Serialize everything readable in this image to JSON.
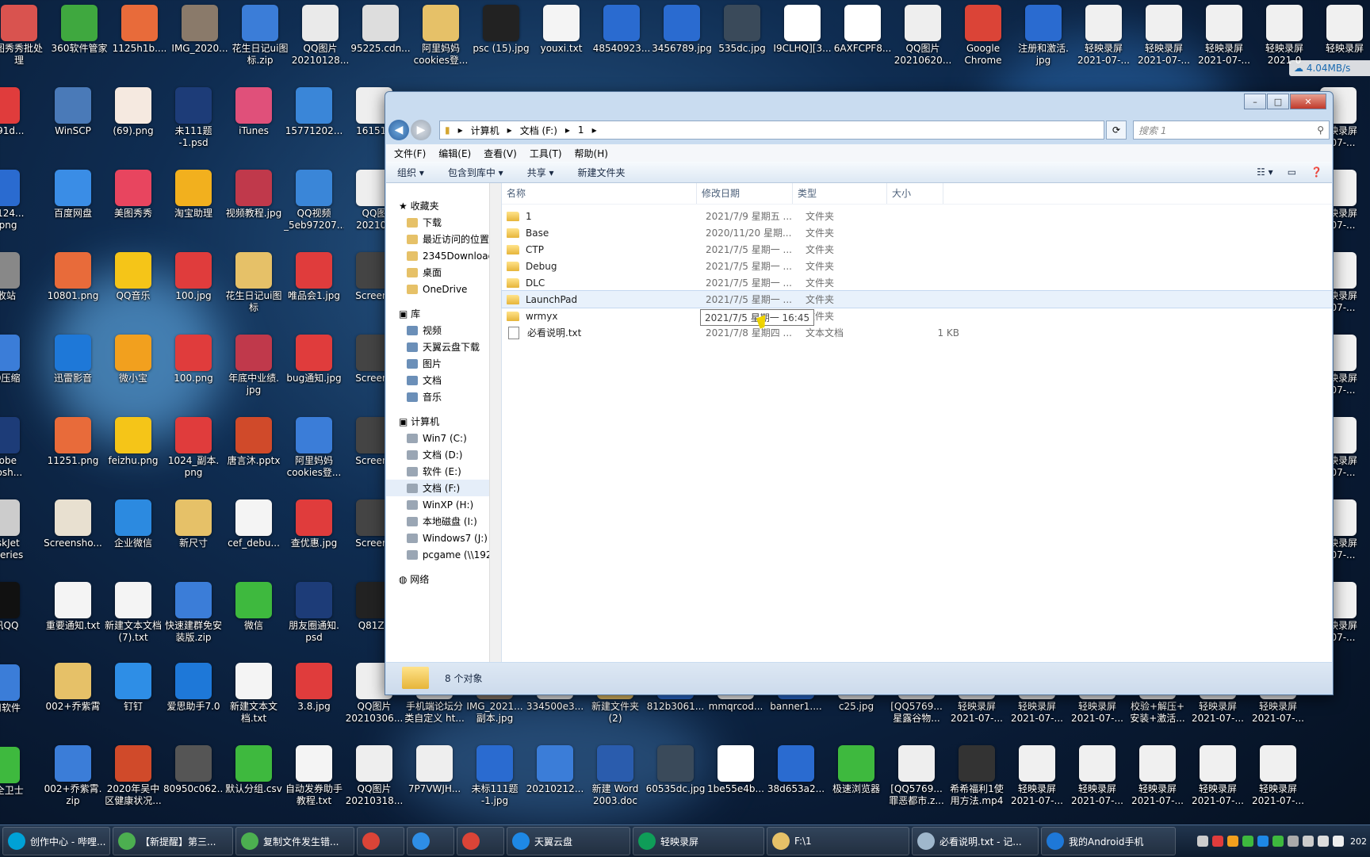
{
  "desktop_icons_top": [
    {
      "label": "图秀秀批处\n理",
      "color": "#d9534f"
    },
    {
      "label": "360软件管家",
      "color": "#3fa83f"
    },
    {
      "label": "1125h1b....",
      "color": "#e86b3a"
    },
    {
      "label": "IMG_2020...",
      "color": "#8a7a6a"
    },
    {
      "label": "花生日记ui图\n标.zip",
      "color": "#3b7dd8"
    },
    {
      "label": "QQ图片\n20210128...",
      "color": "#eaeaea"
    },
    {
      "label": "95225.cdn...",
      "color": "#dddddd"
    },
    {
      "label": "阿里妈妈\ncookies登...",
      "color": "#e6c168"
    },
    {
      "label": "psc (15).jpg",
      "color": "#222222"
    },
    {
      "label": "youxi.txt",
      "color": "#f4f4f4"
    },
    {
      "label": "48540923...",
      "color": "#2a6bd0"
    },
    {
      "label": "3456789.jpg",
      "color": "#2a6bd0"
    },
    {
      "label": "535dc.jpg",
      "color": "#3a4a5a"
    },
    {
      "label": "I9CLHQ][3...",
      "color": "#ffffff"
    },
    {
      "label": "6AXFCPF8...",
      "color": "#ffffff"
    },
    {
      "label": "QQ图片\n20210620...",
      "color": "#eeeeee"
    },
    {
      "label": "Google\nChrome",
      "color": "#db4437"
    },
    {
      "label": "注册和激活.\njpg",
      "color": "#2a6bd0"
    },
    {
      "label": "轻映录屏\n2021-07-...",
      "color": "#f0f0f0"
    },
    {
      "label": "轻映录屏\n2021-07-...",
      "color": "#f0f0f0"
    },
    {
      "label": "轻映录屏\n2021-07-...",
      "color": "#f0f0f0"
    },
    {
      "label": "轻映录屏\n2021-0",
      "color": "#f0f0f0"
    },
    {
      "label": "轻映录屏",
      "color": "#f0f0f0"
    }
  ],
  "desktop_icons_left": [
    {
      "label": "WinSCP",
      "color": "#4a7ab8"
    },
    {
      "label": "(69).png",
      "color": "#f5e9e0"
    },
    {
      "label": "未111题\n-1.psd",
      "color": "#1d3c78"
    },
    {
      "label": "iTunes",
      "color": "#e0507a"
    },
    {
      "label": "15771202...",
      "color": "#3a86d8"
    },
    {
      "label": "161517",
      "color": "#eeeeee"
    },
    {
      "label": "百度网盘",
      "color": "#3a8de6"
    },
    {
      "label": "美图秀秀",
      "color": "#e8455f"
    },
    {
      "label": "淘宝助理",
      "color": "#f2b01e"
    },
    {
      "label": "视频教程.jpg",
      "color": "#c0394b"
    },
    {
      "label": "QQ视频\n_5eb97207...",
      "color": "#3a86d8"
    },
    {
      "label": "QQ图\n202103",
      "color": "#eeeeee"
    },
    {
      "label": "10801.png",
      "color": "#e86b3a"
    },
    {
      "label": "QQ音乐",
      "color": "#f5c518"
    },
    {
      "label": "100.jpg",
      "color": "#e03c3c"
    },
    {
      "label": "花生日记ui图\n标",
      "color": "#e6c168"
    },
    {
      "label": "唯品会1.jpg",
      "color": "#e03c3c"
    },
    {
      "label": "Screens",
      "color": "#444444"
    },
    {
      "label": "迅雷影音",
      "color": "#1e78d8"
    },
    {
      "label": "微小宝",
      "color": "#f2a01e"
    },
    {
      "label": "100.png",
      "color": "#e03c3c"
    },
    {
      "label": "年底中业绩.\njpg",
      "color": "#c0394b"
    },
    {
      "label": "bug通知.jpg",
      "color": "#e03c3c"
    },
    {
      "label": "Screens",
      "color": "#444444"
    },
    {
      "label": "11251.png",
      "color": "#e86b3a"
    },
    {
      "label": "feizhu.png",
      "color": "#f5c518"
    },
    {
      "label": "1024_副本.\npng",
      "color": "#e03c3c"
    },
    {
      "label": "唐言沐.pptx",
      "color": "#d04a2a"
    },
    {
      "label": "阿里妈妈\ncookies登...",
      "color": "#3b7dd8"
    },
    {
      "label": "Screens",
      "color": "#444444"
    },
    {
      "label": "Screensho...",
      "color": "#e8e0d0"
    },
    {
      "label": "企业微信",
      "color": "#2c8ae0"
    },
    {
      "label": "新尺寸",
      "color": "#e6c168"
    },
    {
      "label": "cef_debu...",
      "color": "#f4f4f4"
    },
    {
      "label": "查优惠.jpg",
      "color": "#e03c3c"
    },
    {
      "label": "Screens",
      "color": "#444444"
    },
    {
      "label": "重要通知.txt",
      "color": "#f4f4f4"
    },
    {
      "label": "新建文本文档\n(7).txt",
      "color": "#f4f4f4"
    },
    {
      "label": "快速建群免安\n装版.zip",
      "color": "#3b7dd8"
    },
    {
      "label": "微信",
      "color": "#3eb93e"
    },
    {
      "label": "朋友圈通知.\npsd",
      "color": "#1d3c78"
    },
    {
      "label": "Q81Z7",
      "color": "#222222"
    }
  ],
  "desktop_icons_bottom": [
    {
      "label": "002+乔紫霄",
      "color": "#e6c168"
    },
    {
      "label": "钉钉",
      "color": "#2e8ee6"
    },
    {
      "label": "爱思助手7.0",
      "color": "#1e78d8"
    },
    {
      "label": "新建文本文\n档.txt",
      "color": "#f4f4f4"
    },
    {
      "label": "3.8.jpg",
      "color": "#e03c3c"
    },
    {
      "label": "QQ图片\n20210306...",
      "color": "#eeeeee"
    },
    {
      "label": "手机端论坛分\n类自定义 ht...",
      "color": "#eeeeee"
    },
    {
      "label": "IMG_2021...\n副本.jpg",
      "color": "#8a7a6a"
    },
    {
      "label": "334500e3...",
      "color": "#eeeeee"
    },
    {
      "label": "新建文件夹\n(2)",
      "color": "#e6c168"
    },
    {
      "label": "812b3061...",
      "color": "#2a6bd0"
    },
    {
      "label": "mmqrcod...",
      "color": "#ffffff"
    },
    {
      "label": "banner1....",
      "color": "#2a6bd0"
    },
    {
      "label": "c25.jpg",
      "color": "#eeeeee"
    },
    {
      "label": "[QQ5769...\n星露谷物...",
      "color": "#eeeeee"
    },
    {
      "label": "轻映录屏\n2021-07-...",
      "color": "#f0f0f0"
    },
    {
      "label": "轻映录屏\n2021-07-...",
      "color": "#f0f0f0"
    },
    {
      "label": "轻映录屏\n2021-07-...",
      "color": "#f0f0f0"
    },
    {
      "label": "校验+解压+\n安装+激活...",
      "color": "#f0f0f0"
    },
    {
      "label": "轻映录屏\n2021-07-...",
      "color": "#f0f0f0"
    },
    {
      "label": "轻映录屏\n2021-07-...",
      "color": "#f0f0f0"
    },
    {
      "label": "002+乔紫霄.\nzip",
      "color": "#3b7dd8"
    },
    {
      "label": "2020年吴中\n区健康状况...",
      "color": "#d04a2a"
    },
    {
      "label": "80950c062...",
      "color": "#555555"
    },
    {
      "label": "默认分组.csv",
      "color": "#3eb93e"
    },
    {
      "label": "自动发券助手\n教程.txt",
      "color": "#f4f4f4"
    },
    {
      "label": "QQ图片\n20210318...",
      "color": "#eeeeee"
    },
    {
      "label": "7P7VWJH...",
      "color": "#eeeeee"
    },
    {
      "label": "未标111题\n-1.jpg",
      "color": "#2a6bd0"
    },
    {
      "label": "20210212...",
      "color": "#3b7dd8"
    },
    {
      "label": "新建 Word\n2003.doc",
      "color": "#2a5cad"
    },
    {
      "label": "60535dc.jpg",
      "color": "#3a4a5a"
    },
    {
      "label": "1be55e4b...",
      "color": "#ffffff"
    },
    {
      "label": "38d653a2...",
      "color": "#2a6bd0"
    },
    {
      "label": "极速浏览器",
      "color": "#3eb93e"
    },
    {
      "label": "[QQ5769...\n罪恶都市.z...",
      "color": "#eeeeee"
    },
    {
      "label": "希希福利1使\n用方法.mp4",
      "color": "#333333"
    },
    {
      "label": "轻映录屏\n2021-07-...",
      "color": "#f0f0f0"
    },
    {
      "label": "轻映录屏\n2021-07-...",
      "color": "#f0f0f0"
    },
    {
      "label": "轻映录屏\n2021-07-...",
      "color": "#f0f0f0"
    },
    {
      "label": "轻映录屏\n2021-07-...",
      "color": "#f0f0f0"
    },
    {
      "label": "轻映录屏\n2021-07-...",
      "color": "#f0f0f0"
    }
  ],
  "explorer": {
    "path": [
      "计算机",
      "文档 (F:)",
      "1"
    ],
    "search_placeholder": "搜索 1",
    "menu": [
      "文件(F)",
      "编辑(E)",
      "查看(V)",
      "工具(T)",
      "帮助(H)"
    ],
    "toolbar": [
      "组织 ▾",
      "包含到库中 ▾",
      "共享 ▾",
      "新建文件夹"
    ],
    "nav": {
      "favorites_title": "收藏夹",
      "favorites": [
        "下载",
        "最近访问的位置",
        "2345Download",
        "桌面",
        "OneDrive"
      ],
      "library_title": "库",
      "library": [
        "视频",
        "天翼云盘下载",
        "图片",
        "文档",
        "音乐"
      ],
      "computer_title": "计算机",
      "computer": [
        "Win7 (C:)",
        "文档 (D:)",
        "软件 (E:)",
        "文档 (F:)",
        "WinXP (H:)",
        "本地磁盘 (I:)",
        "Windows7 (J:)",
        "pcgame (\\\\192..."
      ],
      "network_title": "网络"
    },
    "columns": [
      "名称",
      "修改日期",
      "类型",
      "大小"
    ],
    "files": [
      {
        "name": "1",
        "date": "2021/7/9 星期五 ...",
        "type": "文件夹",
        "size": "",
        "kind": "folder"
      },
      {
        "name": "Base",
        "date": "2020/11/20 星期...",
        "type": "文件夹",
        "size": "",
        "kind": "folder"
      },
      {
        "name": "CTP",
        "date": "2021/7/5 星期一 ...",
        "type": "文件夹",
        "size": "",
        "kind": "folder"
      },
      {
        "name": "Debug",
        "date": "2021/7/5 星期一 ...",
        "type": "文件夹",
        "size": "",
        "kind": "folder"
      },
      {
        "name": "DLC",
        "date": "2021/7/5 星期一 ...",
        "type": "文件夹",
        "size": "",
        "kind": "folder"
      },
      {
        "name": "LaunchPad",
        "date": "2021/7/5 星期一 ...",
        "type": "文件夹",
        "size": "",
        "kind": "folder"
      },
      {
        "name": "wrmyx",
        "date": "2021/7/8 星期四 ...",
        "type": "文件夹",
        "size": "",
        "kind": "folder"
      },
      {
        "name": "必看说明.txt",
        "date": "2021/7/8 星期四 ...",
        "type": "文本文档",
        "size": "1 KB",
        "kind": "txt"
      }
    ],
    "tooltip": "2021/7/5 星期一 16:45",
    "status": "8 个对象"
  },
  "taskbar": [
    {
      "label": "创作中心 - 哔哩...",
      "color": "#00a1d6"
    },
    {
      "label": "【新提醒】第三...",
      "color": "#4caf50"
    },
    {
      "label": "复制文件发生错...",
      "color": "#4caf50"
    },
    {
      "label": "",
      "color": "#db4437"
    },
    {
      "label": "",
      "color": "#2e8ee6"
    },
    {
      "label": "",
      "color": "#db4437"
    },
    {
      "label": "天翼云盘",
      "color": "#1e88e5"
    },
    {
      "label": "轻映录屏",
      "color": "#0f9d58"
    },
    {
      "label": "F:\\1",
      "color": "#e6c168"
    },
    {
      "label": "必看说明.txt - 记...",
      "color": "#9fb7cc"
    },
    {
      "label": "我的Android手机",
      "color": "#1e78d8"
    }
  ],
  "tray": {
    "speed": "4.04MB/s",
    "clock": "202"
  }
}
